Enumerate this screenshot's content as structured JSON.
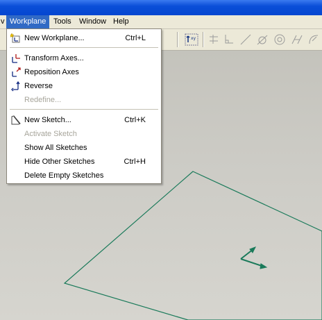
{
  "menubar": {
    "items": [
      {
        "label": "v"
      },
      {
        "label": "Workplane"
      },
      {
        "label": "Tools"
      },
      {
        "label": "Window"
      },
      {
        "label": "Help"
      }
    ]
  },
  "workplane_menu": {
    "items": [
      {
        "label": "New Workplane...",
        "shortcut": "Ctrl+L",
        "icon": "new-workplane-icon",
        "enabled": true
      },
      {
        "label": "Transform Axes...",
        "shortcut": "",
        "icon": "transform-axes-icon",
        "enabled": true
      },
      {
        "label": "Reposition Axes",
        "shortcut": "",
        "icon": "reposition-axes-icon",
        "enabled": true
      },
      {
        "label": "Reverse",
        "shortcut": "",
        "icon": "reverse-icon",
        "enabled": true
      },
      {
        "label": "Redefine...",
        "shortcut": "",
        "icon": "",
        "enabled": false
      },
      {
        "label": "New Sketch...",
        "shortcut": "Ctrl+K",
        "icon": "new-sketch-icon",
        "enabled": true
      },
      {
        "label": "Activate Sketch",
        "shortcut": "",
        "icon": "",
        "enabled": false
      },
      {
        "label": "Show All Sketches",
        "shortcut": "",
        "icon": "",
        "enabled": true
      },
      {
        "label": "Hide Other Sketches",
        "shortcut": "Ctrl+H",
        "icon": "",
        "enabled": true
      },
      {
        "label": "Delete Empty Sketches",
        "shortcut": "",
        "icon": "",
        "enabled": true
      }
    ]
  },
  "colors": {
    "menu_highlight": "#316ac5",
    "workplane_outline": "#1a7a5a",
    "titlebar": "#0a4fd8"
  }
}
